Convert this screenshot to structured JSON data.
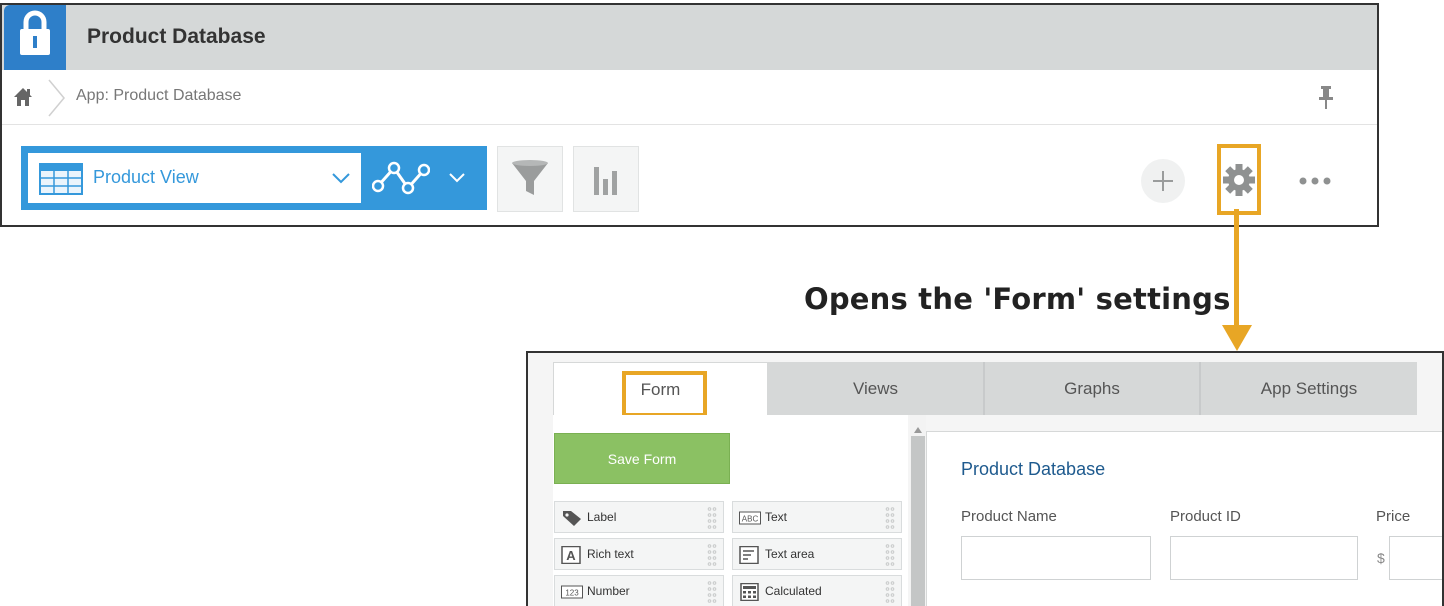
{
  "app": {
    "title": "Product Database",
    "icon": "lock-icon"
  },
  "breadcrumb": {
    "text": "App: Product Database"
  },
  "toolbar": {
    "view_label": "Product View",
    "icons": [
      "table-icon",
      "graph-icon",
      "filter-icon",
      "bar-chart-icon",
      "plus-icon",
      "gear-icon",
      "more-icon",
      "pin-icon",
      "home-icon"
    ]
  },
  "annotation": {
    "text": "Opens the 'Form' settings"
  },
  "settings": {
    "tabs": [
      {
        "label": "Form"
      },
      {
        "label": "Views"
      },
      {
        "label": "Graphs"
      },
      {
        "label": "App Settings"
      }
    ],
    "save_label": "Save Form",
    "fields": [
      {
        "label": "Label",
        "icon": "tag-icon"
      },
      {
        "label": "Text",
        "icon": "abc-icon"
      },
      {
        "label": "Rich text",
        "icon": "rich-text-icon"
      },
      {
        "label": "Text area",
        "icon": "text-area-icon"
      },
      {
        "label": "Number",
        "icon": "number-icon"
      },
      {
        "label": "Calculated",
        "icon": "calculator-icon"
      }
    ],
    "form": {
      "title": "Product Database",
      "columns": [
        {
          "label": "Product Name"
        },
        {
          "label": "Product ID"
        },
        {
          "label": "Price",
          "prefix": "$"
        }
      ]
    }
  },
  "colors": {
    "accent": "#3498db",
    "highlight": "#e8a625",
    "save_green": "#8bc163",
    "title_bar": "#d5d8d8"
  }
}
